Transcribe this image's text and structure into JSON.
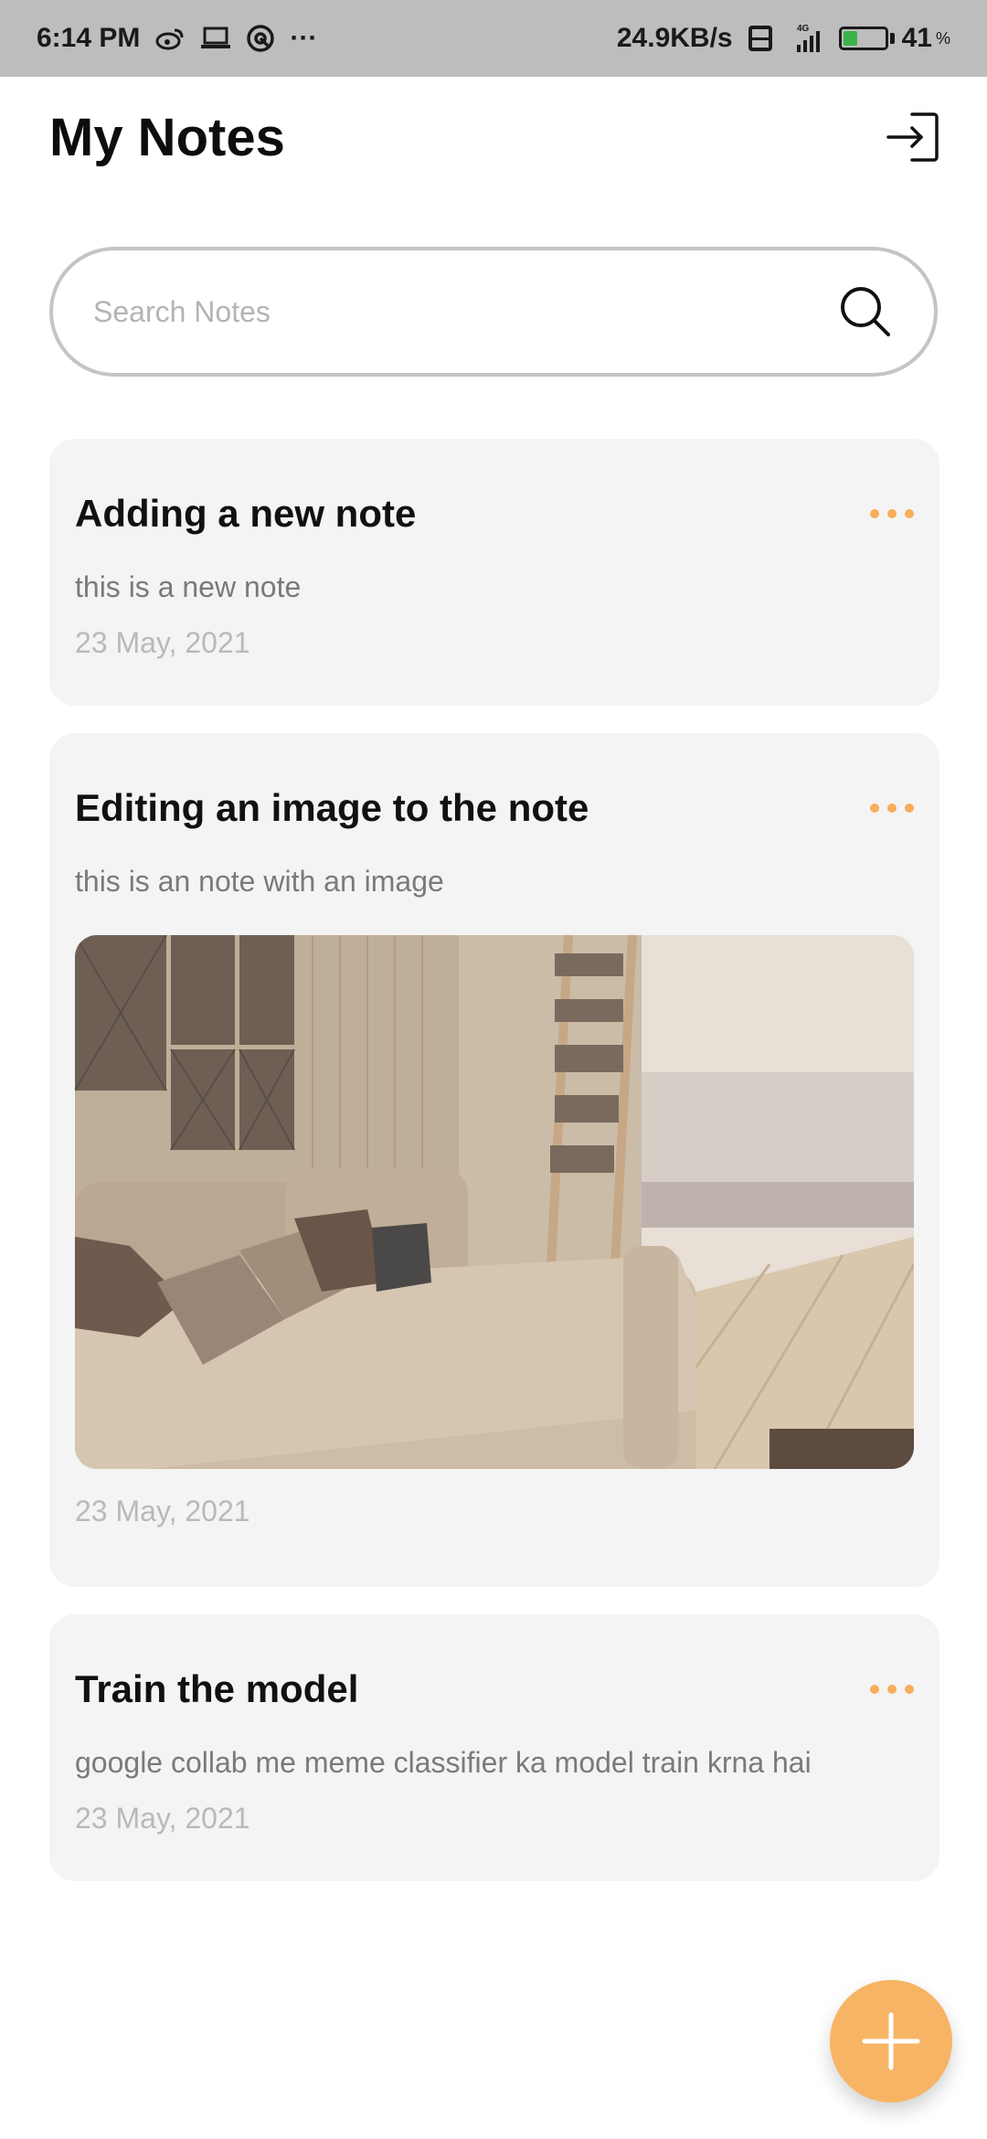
{
  "status_bar": {
    "time": "6:14 PM",
    "overflow": "···",
    "speed": "24.9KB/s",
    "network": "4G",
    "battery_level": 41,
    "battery_text": "41",
    "battery_suffix": "%"
  },
  "header": {
    "title": "My Notes"
  },
  "search": {
    "placeholder": "Search Notes",
    "value": ""
  },
  "notes": [
    {
      "title": "Adding a new note",
      "body": "this is a new note",
      "date": "23 May, 2021"
    },
    {
      "title": "Editing an image to the note",
      "body": "this is an note with an image",
      "date": "23 May, 2021",
      "image": "living-room-sofa"
    },
    {
      "title": "Train the model",
      "body": "google collab me meme classifier ka model train krna hai",
      "date": "23 May, 2021"
    }
  ],
  "colors": {
    "accent": "#f7b464",
    "card_bg": "#f4f4f4",
    "status_bar": "#bdbdbd"
  },
  "icons": {
    "logout": "logout-icon",
    "search": "search-icon",
    "more": "more-icon",
    "add": "plus-icon"
  }
}
